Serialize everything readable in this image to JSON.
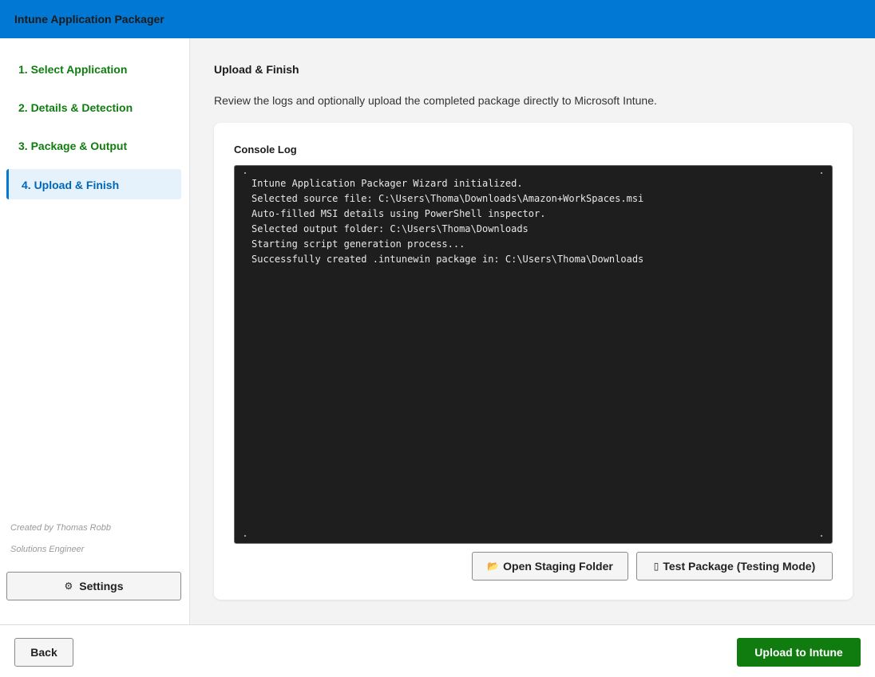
{
  "app": {
    "title": "Intune Application Packager"
  },
  "sidebar": {
    "steps": [
      {
        "label": "1. Select Application",
        "state": "complete"
      },
      {
        "label": "2. Details & Detection",
        "state": "complete"
      },
      {
        "label": "3. Package & Output",
        "state": "complete"
      },
      {
        "label": "4. Upload & Finish",
        "state": "active"
      }
    ],
    "credit_name": "Created by Thomas Robb",
    "credit_role": "Solutions Engineer",
    "settings": {
      "icon": "gear-icon",
      "label": "Settings"
    }
  },
  "main": {
    "title": "Upload & Finish",
    "description": "Review the logs and optionally upload the completed package directly to Microsoft Intune.",
    "console": {
      "label": "Console Log",
      "lines": [
        "Intune Application Packager Wizard initialized.",
        "Selected source file: C:\\Users\\Thoma\\Downloads\\Amazon+WorkSpaces.msi",
        "Auto-filled MSI details using PowerShell inspector.",
        "Selected output folder: C:\\Users\\Thoma\\Downloads",
        "Starting script generation process...",
        "Successfully created .intunewin package in: C:\\Users\\Thoma\\Downloads"
      ]
    },
    "buttons": {
      "open_staging": {
        "icon": "folder-icon",
        "label": "Open Staging Folder"
      },
      "test_package": {
        "icon": "test-icon",
        "label": "Test Package (Testing Mode)"
      }
    }
  },
  "footer": {
    "back_label": "Back",
    "upload_label": "Upload to Intune"
  },
  "colors": {
    "header": "#0078d4",
    "step_complete": "#107c10",
    "step_active": "#0067b8",
    "upload_button": "#107c10",
    "console_bg": "#1e1e1e"
  }
}
